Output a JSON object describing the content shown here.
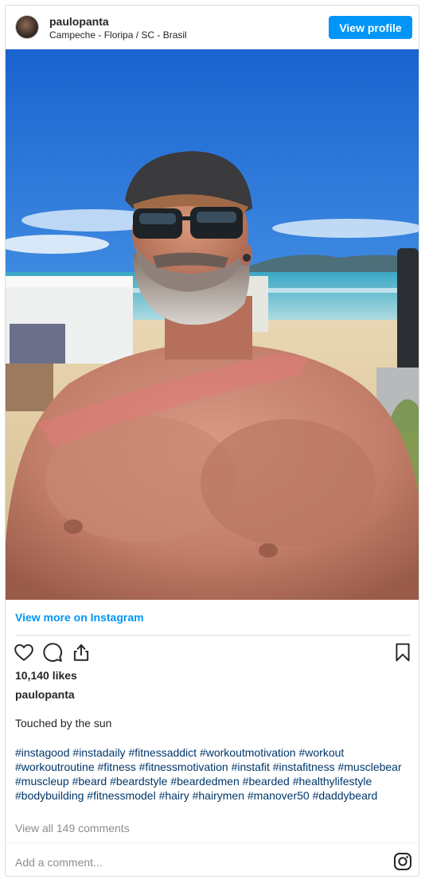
{
  "header": {
    "username": "paulopanta",
    "location": "Campeche - Floripa / SC - Brasil",
    "view_profile_label": "View profile"
  },
  "view_more_label": "View more on Instagram",
  "likes": "10,140 likes",
  "post_username": "paulopanta",
  "caption": "Touched by the sun",
  "hashtags": [
    "#instagood",
    "#instadaily",
    "#fitnessaddict",
    "#workoutmotivation",
    "#workout",
    "#workoutroutine",
    "#fitness",
    "#fitnessmotivation",
    "#instafit",
    "#instafitness",
    "#musclebear",
    "#muscleup",
    "#beard",
    "#beardstyle",
    "#beardedmen",
    "#bearded",
    "#healthylifestyle",
    "#bodybuilding",
    "#fitnessmodel",
    "#hairy",
    "#hairymen",
    "#manover50",
    "#daddybeard"
  ],
  "comments_label": "View all 149 comments",
  "add_comment_placeholder": "Add a comment...",
  "icons": [
    "heart-icon",
    "comment-icon",
    "share-icon",
    "bookmark-icon",
    "instagram-icon"
  ],
  "colors": {
    "accent": "#0095f6",
    "hashtag": "#00376b",
    "muted": "#8e8e8e",
    "text": "#262626"
  }
}
